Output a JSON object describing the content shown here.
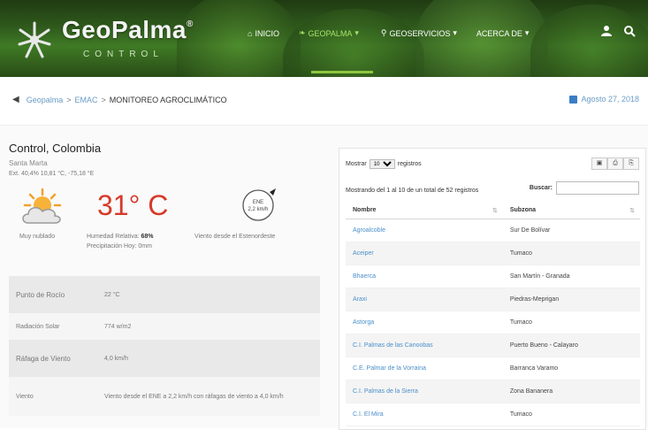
{
  "brand": {
    "name": "GeoPalma",
    "sub": "CONTROL",
    "reg": "®"
  },
  "nav": [
    {
      "label": "INICIO",
      "icon": "home-icon"
    },
    {
      "label": "GEOPALMA",
      "icon": "leaf-icon",
      "active": true
    },
    {
      "label": "GEOSERVICIOS",
      "icon": "map-pin-icon"
    },
    {
      "label": "ACERCA DE",
      "icon": "none"
    }
  ],
  "nav_carets": [
    "▾",
    "▾",
    "▾"
  ],
  "header_icons": [
    "user-icon",
    "search-icon"
  ],
  "breadcrumb": {
    "items": [
      "Geopalma",
      "EMAC",
      "MONITOREO AGROCLIMÁTICO"
    ],
    "sep": ">"
  },
  "date": "Agosto 27, 2018",
  "weather": {
    "location": "Control, Colombia",
    "place": "Santa Marta",
    "coords": "Ext. 40,4% 10,81 °C, -75,18 °E",
    "temperature": "31° C",
    "condition": "Muy nublado",
    "humidity_label": "Humedad Relativa:",
    "humidity_value": "68%",
    "precip_label": "Precipitación Hoy:",
    "precip_value": "0mm",
    "wind_text": "Viento desde el Estenordeste",
    "compass_dir": "ENE",
    "compass_speed": "2,2 km/h",
    "accent": "#d63a2a"
  },
  "details": [
    {
      "key": "Punto de Rocío",
      "value": "22 °C"
    },
    {
      "key": "Radiación Solar",
      "value": "774 w/m2"
    },
    {
      "key": "Ráfaga de Viento",
      "value": "4,0 km/h"
    },
    {
      "key": "Viento",
      "value": "Viento desde el ENE a 2,2 km/h con ráfagas de viento a 4,0 km/h"
    }
  ],
  "table": {
    "show_label": "Mostrar",
    "show_value": "10",
    "records_label": "registros",
    "info": "Mostrando del 1 al 10 de un total de 52 registros",
    "search_label": "Buscar:",
    "search_value": "",
    "tools": [
      "▣",
      "⎙",
      "⎘"
    ],
    "columns": [
      "Nombre",
      "Subzona"
    ],
    "sort_icon": "⇅",
    "rows": [
      [
        "Agroalcoble",
        "Sur De Bolívar"
      ],
      [
        "Aceiper",
        "Tumaco"
      ],
      [
        "Bhaerca",
        "San Martín - Granada"
      ],
      [
        "Araxi",
        "Piedras-Meprigan"
      ],
      [
        "Astorga",
        "Tumaco"
      ],
      [
        "C.I. Palmas de las Canoobas",
        "Puerto Bueno - Calayaro"
      ],
      [
        "C.E. Palmar de la Vorraina",
        "Barranca Varamo"
      ],
      [
        "C.I. Palmas de la Sierra",
        "Zona Bananera"
      ],
      [
        "C.I. El Mira",
        "Tumaco"
      ]
    ]
  }
}
